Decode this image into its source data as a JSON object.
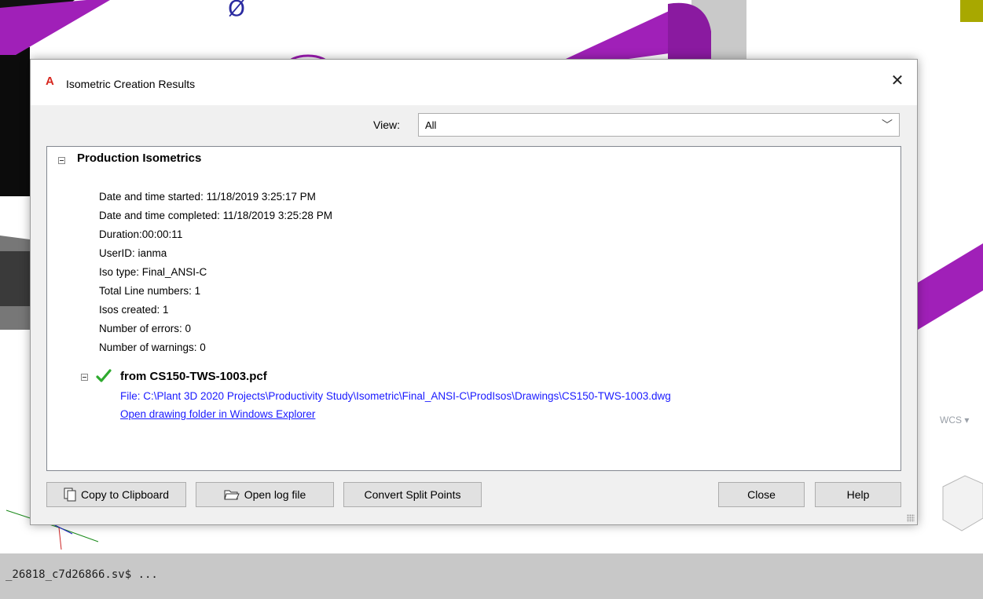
{
  "dialog": {
    "title": "Isometric Creation Results",
    "close_glyph": "✕",
    "view": {
      "label": "View:",
      "selected": "All"
    }
  },
  "results": {
    "section_title": "Production Isometrics",
    "info": [
      "Date and time started: 11/18/2019 3:25:17 PM",
      "Date and time completed: 11/18/2019 3:25:28 PM",
      "Duration:00:00:11",
      "UserID: ianma",
      "Iso type: Final_ANSI-C",
      "Total Line numbers: 1",
      "Isos created: 1",
      "Number of errors: 0",
      "Number of warnings: 0"
    ],
    "pcf": {
      "title": "from CS150-TWS-1003.pcf",
      "file": "File: C:\\Plant 3D 2020 Projects\\Productivity Study\\Isometric\\Final_ANSI-C\\ProdIsos\\Drawings\\CS150-TWS-1003.dwg",
      "open_folder": "Open drawing folder in Windows Explorer"
    }
  },
  "buttons": {
    "copy": "Copy to Clipboard",
    "open_log": "Open log file",
    "convert": "Convert Split Points",
    "close": "Close",
    "help": "Help"
  },
  "viewport": {
    "wcs_label": "WCS ▾"
  },
  "command_line": {
    "text": "_26818_c7d26866.sv$ ..."
  },
  "colors": {
    "pipe": "#a020b8",
    "link": "#1a1aff",
    "check": "#2eaa2e",
    "app_icon": "#d7261e"
  },
  "icons": [
    "autocad-a-icon",
    "close-icon",
    "chevron-down-icon",
    "collapse-icon",
    "checkmark-icon",
    "clipboard-icon",
    "folder-open-icon",
    "resize-grip-icon"
  ]
}
